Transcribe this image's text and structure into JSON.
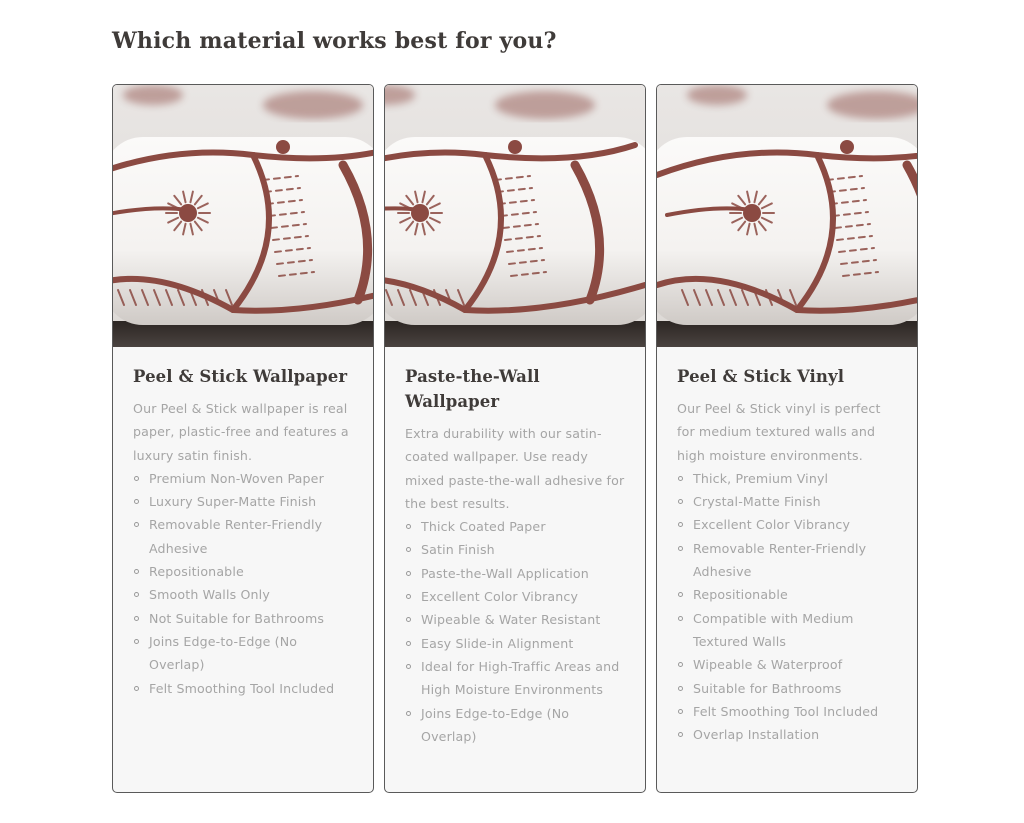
{
  "section": {
    "heading": "Which material works best for you?"
  },
  "cards": [
    {
      "title": "Peel & Stick Wallpaper",
      "image_alt": "Rolled peel & stick wallpaper with brown floral print",
      "description": "Our Peel & Stick wallpaper is real paper, plastic-free and features a luxury satin finish.",
      "features": [
        "Premium Non-Woven Paper",
        "Luxury Super-Matte Finish",
        "Removable Renter-Friendly Adhesive",
        "Repositionable",
        "Smooth Walls Only",
        "Not Suitable for Bathrooms",
        "Joins Edge-to-Edge (No Overlap)",
        "Felt Smoothing Tool Included"
      ]
    },
    {
      "title": "Paste-the-Wall Wallpaper",
      "image_alt": "Rolled paste-the-wall wallpaper with brown floral print",
      "description": "Extra durability with our satin-coated wallpaper. Use ready mixed paste-the-wall adhesive for the best results.",
      "features": [
        "Thick Coated Paper",
        "Satin Finish",
        "Paste-the-Wall Application",
        "Excellent Color Vibrancy",
        "Wipeable & Water Resistant",
        "Easy Slide-in Alignment",
        "Ideal for High-Traffic Areas and High Moisture Environments",
        "Joins Edge-to-Edge (No Overlap)"
      ]
    },
    {
      "title": "Peel & Stick Vinyl",
      "image_alt": "Rolled peel & stick vinyl with brown floral print",
      "description": "Our Peel & Stick vinyl is perfect for medium textured walls and high moisture environments.",
      "features": [
        "Thick, Premium Vinyl",
        "Crystal-Matte Finish",
        "Excellent Color Vibrancy",
        "Removable Renter-Friendly Adhesive",
        "Repositionable",
        "Compatible with Medium Textured Walls",
        "Wipeable & Waterproof",
        "Suitable for Bathrooms",
        "Felt Smoothing Tool Included",
        "Overlap Installation"
      ]
    }
  ],
  "colors": {
    "print_brown": "#8b4a42",
    "paper_white": "#f4f2f0",
    "heading_text": "#3f3b39",
    "body_text": "#a5a5a5",
    "card_bg": "#f7f7f7",
    "card_border": "#5a5a5a"
  }
}
